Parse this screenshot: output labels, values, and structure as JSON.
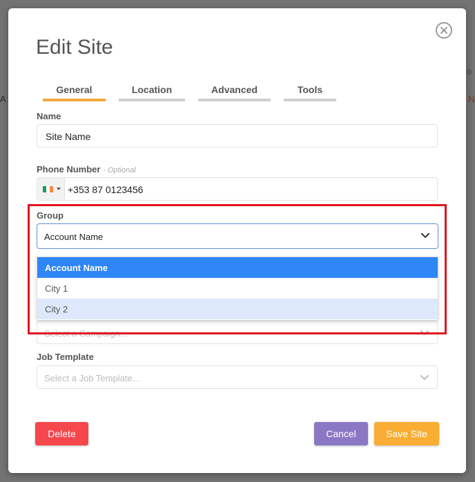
{
  "background": {
    "fragment_left": "A",
    "fragment_right_top": "o",
    "fragment_right": "N"
  },
  "modal": {
    "title": "Edit Site",
    "close_icon": "close-circle-icon"
  },
  "tabs": [
    {
      "label": "General",
      "active": true
    },
    {
      "label": "Location",
      "active": false
    },
    {
      "label": "Advanced",
      "active": false
    },
    {
      "label": "Tools",
      "active": false
    }
  ],
  "form": {
    "name": {
      "label": "Name",
      "value": "Site Name"
    },
    "phone": {
      "label": "Phone Number",
      "optional": "- Optional",
      "country_flag": "ireland-flag-icon",
      "value": "+353 87 0123456"
    },
    "group": {
      "label": "Group",
      "selected": "Account Name",
      "options": [
        "Account Name",
        "City 1",
        "City 2"
      ]
    },
    "campaign": {
      "placeholder": "Select a Campaign..."
    },
    "job_template": {
      "label": "Job Template",
      "placeholder": "Select a Job Template..."
    }
  },
  "buttons": {
    "delete": "Delete",
    "cancel": "Cancel",
    "save": "Save Site"
  },
  "colors": {
    "accent_tab": "#f2a93b",
    "dropdown_selected": "#2f86f6",
    "dropdown_hover": "#dde9fb",
    "delete": "#f5474c",
    "cancel": "#8b78c4",
    "save": "#f9ad33",
    "highlight": "#e0141e"
  }
}
